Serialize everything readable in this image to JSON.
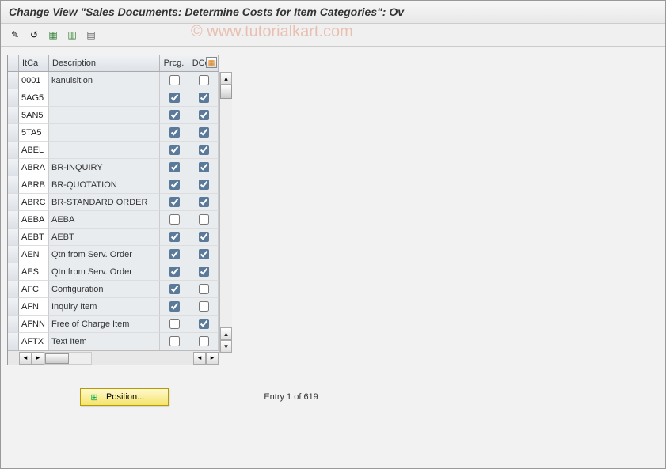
{
  "title": "Change View \"Sales Documents: Determine Costs for Item Categories\": Ov",
  "watermark": "© www.tutorialkart.com",
  "toolbar": {
    "btn1": "toggle-icon",
    "btn2": "undo-icon",
    "btn3": "save-icon",
    "btn4": "save-var-icon",
    "btn5": "select-all-icon"
  },
  "columns": {
    "itca": "ItCa",
    "desc": "Description",
    "prcg": "Prcg.",
    "dcos": "DCos"
  },
  "rows": [
    {
      "itca": "0001",
      "desc": "kanuisition",
      "prcg": false,
      "dcos": false
    },
    {
      "itca": "5AG5",
      "desc": "",
      "prcg": true,
      "dcos": true
    },
    {
      "itca": "5AN5",
      "desc": "",
      "prcg": true,
      "dcos": true
    },
    {
      "itca": "5TA5",
      "desc": "",
      "prcg": true,
      "dcos": true
    },
    {
      "itca": "ABEL",
      "desc": "",
      "prcg": true,
      "dcos": true
    },
    {
      "itca": "ABRA",
      "desc": "BR-INQUIRY",
      "prcg": true,
      "dcos": true
    },
    {
      "itca": "ABRB",
      "desc": "BR-QUOTATION",
      "prcg": true,
      "dcos": true
    },
    {
      "itca": "ABRC",
      "desc": "BR-STANDARD ORDER",
      "prcg": true,
      "dcos": true
    },
    {
      "itca": "AEBA",
      "desc": "AEBA",
      "prcg": false,
      "dcos": false
    },
    {
      "itca": "AEBT",
      "desc": "AEBT",
      "prcg": true,
      "dcos": true
    },
    {
      "itca": "AEN",
      "desc": "Qtn from Serv. Order",
      "prcg": true,
      "dcos": true
    },
    {
      "itca": "AES",
      "desc": "Qtn from Serv. Order",
      "prcg": true,
      "dcos": true
    },
    {
      "itca": "AFC",
      "desc": "Configuration",
      "prcg": true,
      "dcos": false
    },
    {
      "itca": "AFN",
      "desc": "Inquiry Item",
      "prcg": true,
      "dcos": false
    },
    {
      "itca": "AFNN",
      "desc": "Free of Charge Item",
      "prcg": false,
      "dcos": true
    },
    {
      "itca": "AFTX",
      "desc": "Text Item",
      "prcg": false,
      "dcos": false
    }
  ],
  "position_btn": "Position...",
  "entry_text": "Entry 1 of 619"
}
